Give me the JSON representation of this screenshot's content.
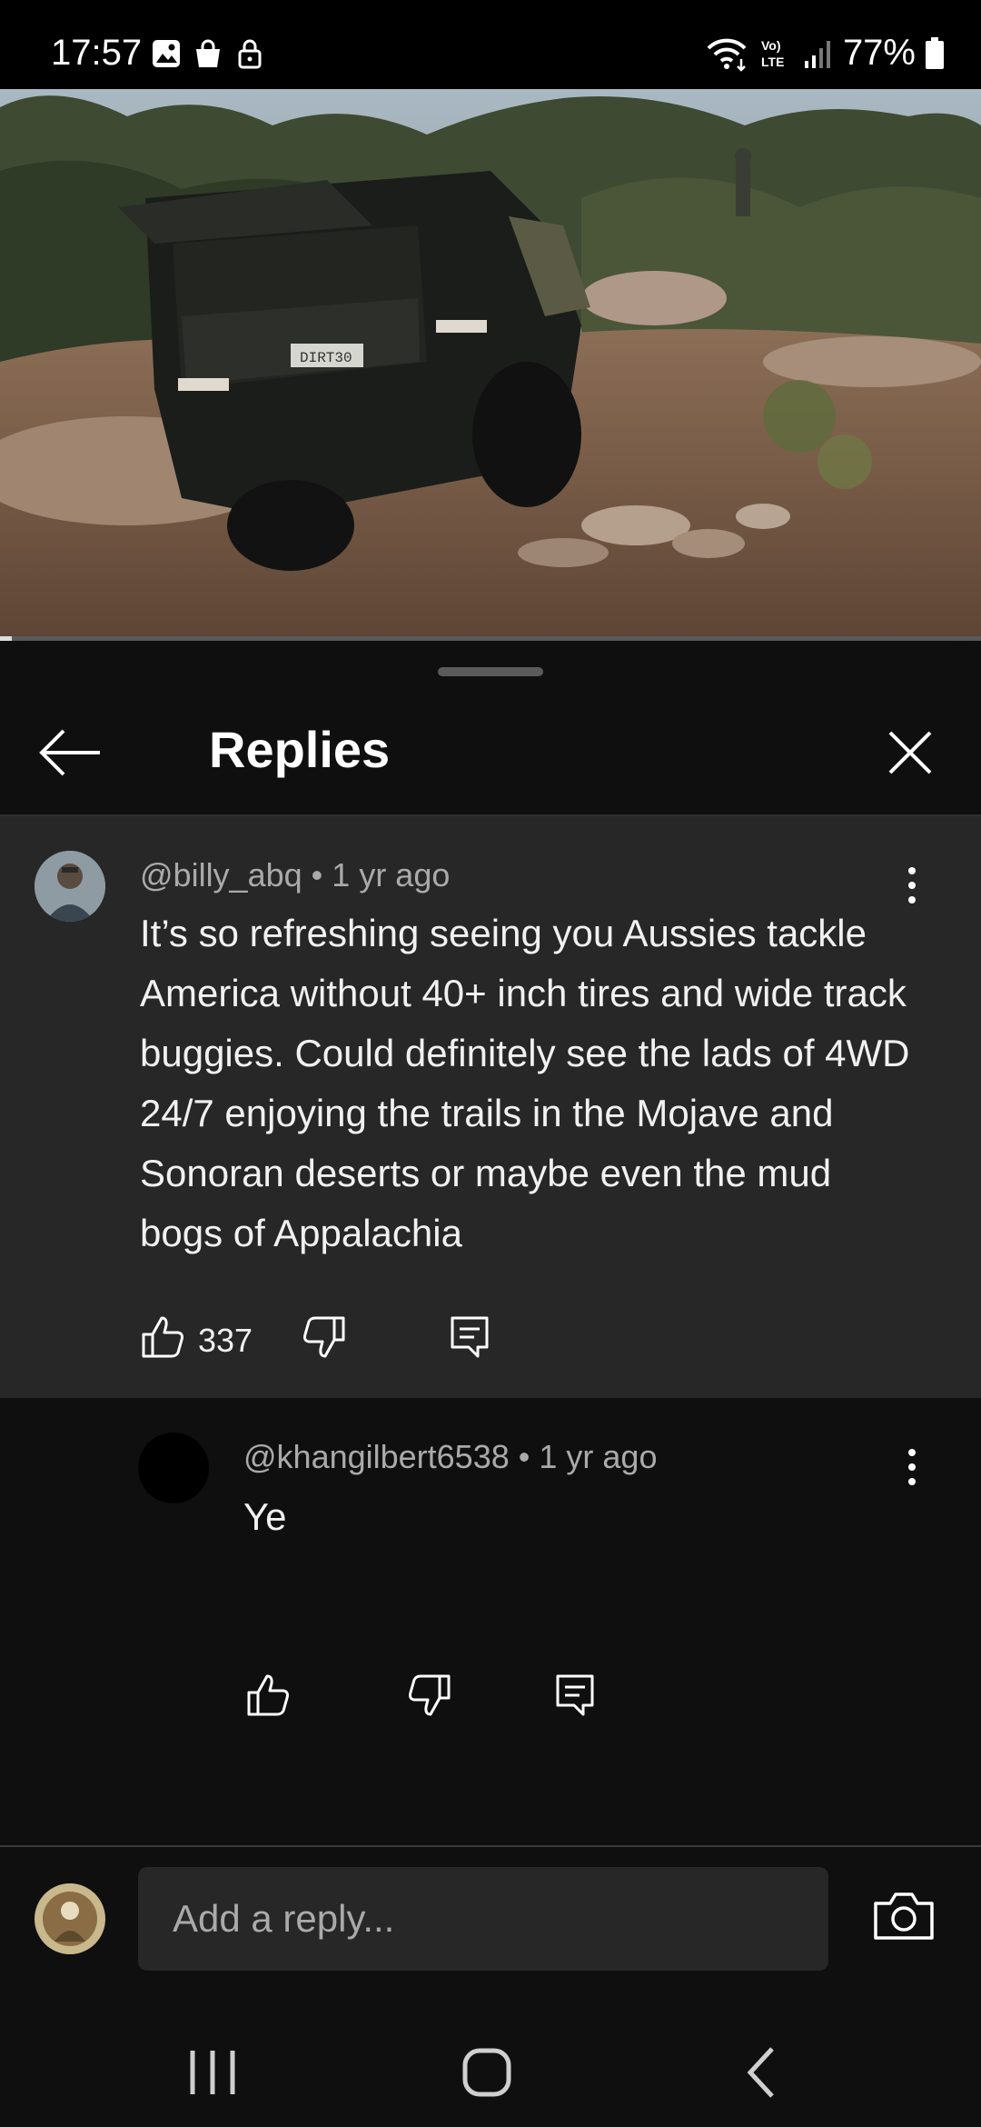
{
  "status_bar": {
    "time": "17:57",
    "battery_percent": "77%",
    "icons_left": [
      "gallery-icon",
      "shopping-bag-icon",
      "lock-icon"
    ],
    "icons_right": [
      "wifi-icon",
      "volte-icon",
      "signal-icon",
      "battery-icon"
    ]
  },
  "video": {
    "progress_fraction": 0.012,
    "plate_text": "DIRT30"
  },
  "panel": {
    "title": "Replies"
  },
  "comment": {
    "author": "@billy_abq",
    "separator": "•",
    "time": "1 yr ago",
    "text": "It’s so refreshing seeing you Aussies tackle America without 40+ inch tires and wide track buggies. Could definitely see the lads of 4WD 24/7 enjoying the trails in the Mojave and Sonoran deserts or maybe even the mud bogs of Appalachia",
    "likes": "337"
  },
  "reply": {
    "author": "@khangilbert6538",
    "separator": "•",
    "time": "1 yr ago",
    "text": "Ye"
  },
  "input": {
    "placeholder": "Add a reply..."
  },
  "colors": {
    "background": "#0f0f0f",
    "highlight": "#272727",
    "secondary_text": "#aaaaaa"
  }
}
